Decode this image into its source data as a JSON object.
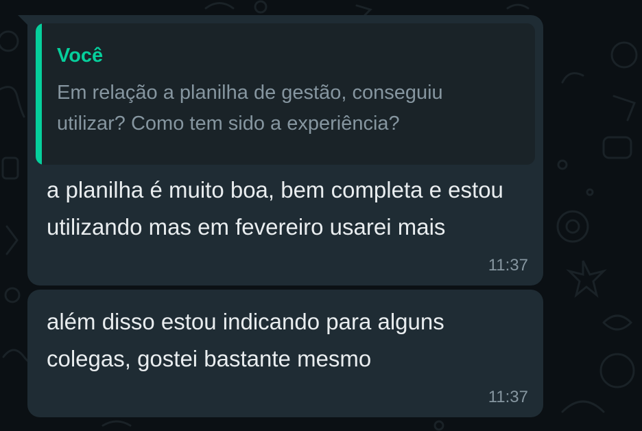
{
  "messages": [
    {
      "quoted": {
        "author": "Você",
        "text": "Em relação a planilha de gestão, conseguiu utilizar? Como tem sido a experiência?"
      },
      "text": "a planilha é muito boa, bem completa e estou utilizando mas em fevereiro usarei mais",
      "time": "11:37"
    },
    {
      "text": "além disso estou indicando para alguns colegas, gostei bastante mesmo",
      "time": "11:37"
    }
  ],
  "colors": {
    "background": "#0b1014",
    "bubble": "#1f2c34",
    "quote_accent": "#06cf9c",
    "primary_text": "#e9edef",
    "secondary_text": "#8696a0"
  }
}
